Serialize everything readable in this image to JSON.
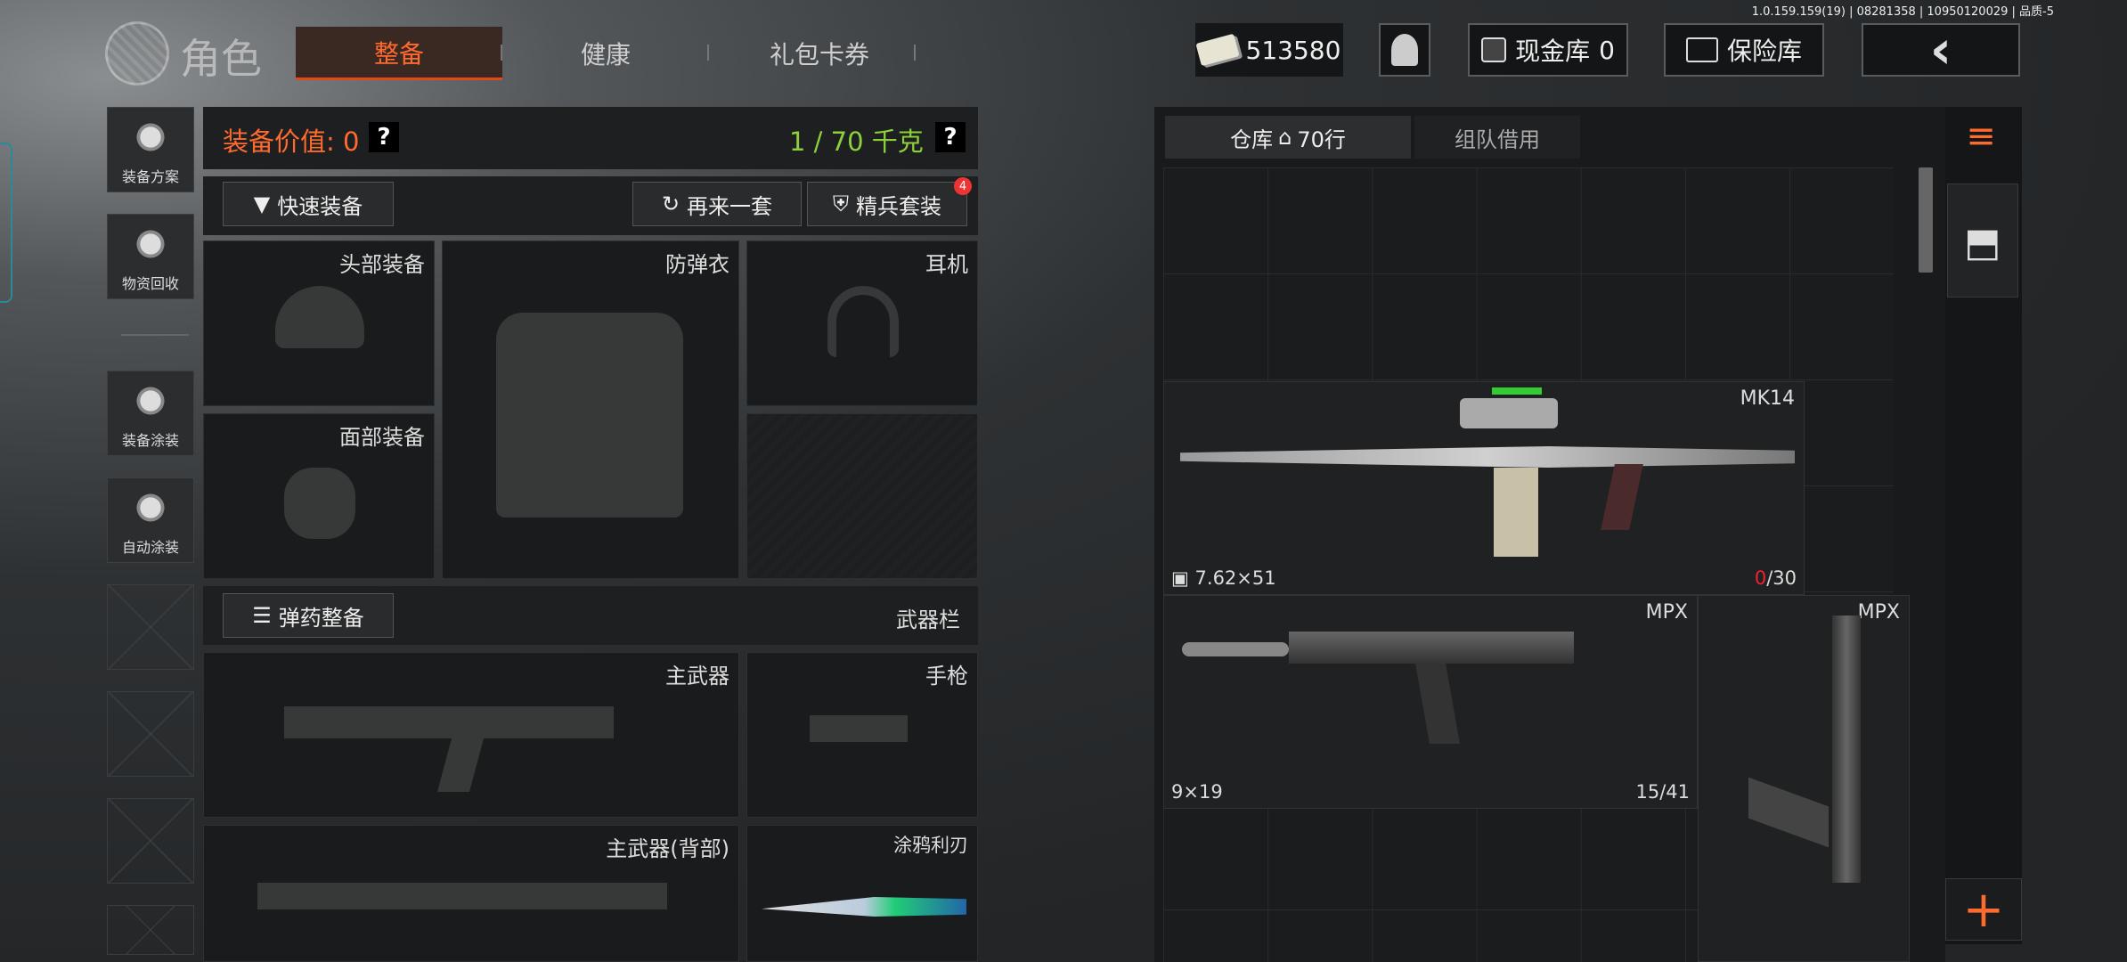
{
  "version": "1.0.159.159(19) | 08281358 | 10950120029 | 品质-5",
  "header": {
    "title": "角色",
    "tabs": [
      "整备",
      "健康",
      "礼包卡券"
    ],
    "money": "513580",
    "cash_label": "现金库",
    "cash_value": "0",
    "vault_label": "保险库"
  },
  "sidebar": {
    "items": [
      "装备方案",
      "物资回收",
      "装备涂装",
      "自动涂装"
    ]
  },
  "equip": {
    "value_label": "装备价值: 0",
    "weight_label": "1 / 70 千克",
    "quick": "快速装备",
    "again": "再来一套",
    "elite": "精兵套装",
    "elite_badge": "4",
    "slots": {
      "head": "头部装备",
      "armor": "防弹衣",
      "ear": "耳机",
      "face": "面部装备"
    },
    "ammo_btn": "弹药整备",
    "weapon_bar": "武器栏",
    "wslots": {
      "primary": "主武器",
      "pistol": "手枪",
      "back": "主武器(背部)",
      "knife": "涂鸦利刃"
    }
  },
  "storage": {
    "tab1": "仓库",
    "tab1_rows": "70行",
    "tab2": "组队借用",
    "items": [
      {
        "name": "MK14",
        "caliber": "7.62×51",
        "ammo_cur": "0",
        "ammo_max": "/30"
      },
      {
        "name": "MPX",
        "caliber": "9×19",
        "ammo": "15/41"
      },
      {
        "name": "MPX"
      }
    ]
  },
  "colors": {
    "accent": "#ff6a2e",
    "weight": "#8dd13a"
  }
}
